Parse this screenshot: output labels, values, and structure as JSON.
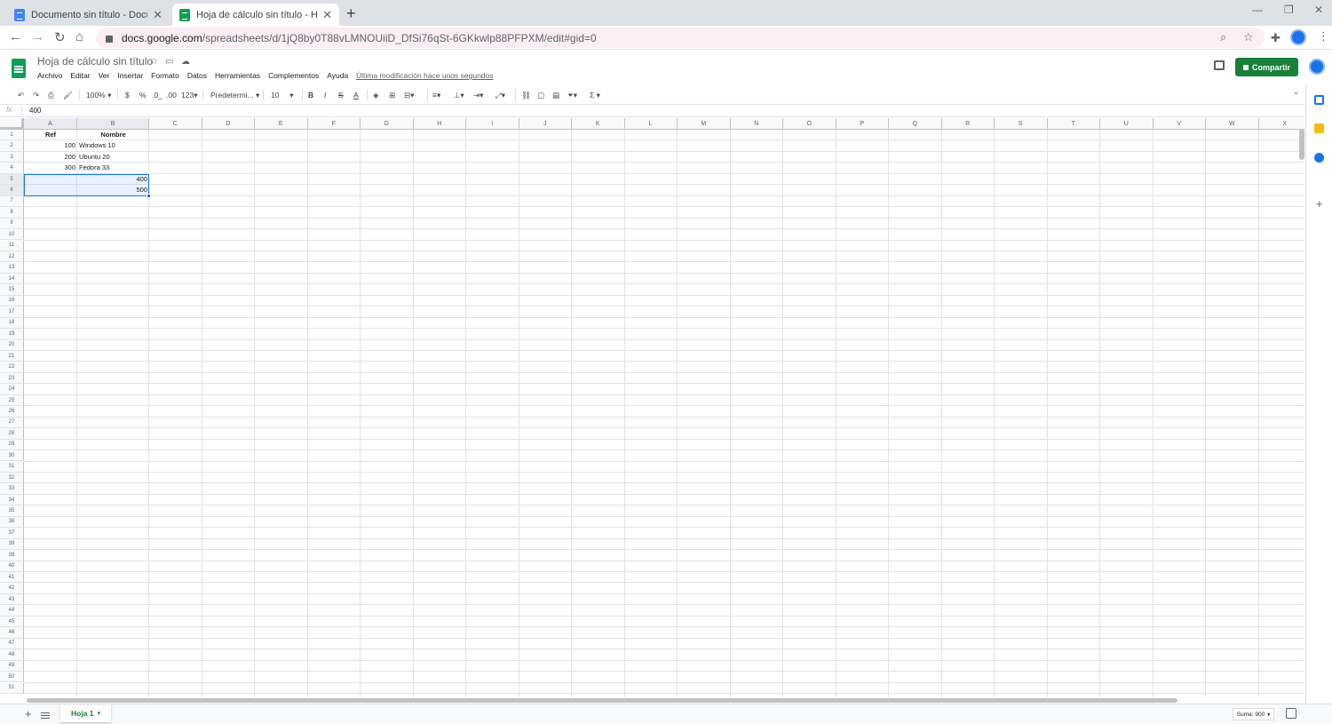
{
  "browser": {
    "tabs": [
      {
        "title": "Documento sin título - Documen"
      },
      {
        "title": "Hoja de cálculo sin título - Hojas"
      }
    ],
    "url_host": "docs.google.com",
    "url_path": "/spreadsheets/d/1jQ8by0T88vLMNOUiiD_DfSi76qSt-6GKkwlp88PFPXM/edit#gid=0"
  },
  "app": {
    "title": "Hoja de cálculo sin título",
    "menu": [
      "Archivo",
      "Editar",
      "Ver",
      "Insertar",
      "Formato",
      "Datos",
      "Herramientas",
      "Complementos",
      "Ayuda"
    ],
    "last_modified": "Última modificación hace unos segundos",
    "share_label": "Compartir"
  },
  "toolbar": {
    "zoom": "100%",
    "currency": "$",
    "percent": "%",
    "dec_minus": ".0_",
    "dec_plus": ".00",
    "more_formats": "123",
    "font": "Predetermi...",
    "font_size": "10",
    "bold": "B",
    "italic": "I",
    "strike": "S",
    "text_color": "A",
    "sigma": "Σ"
  },
  "formula_bar": {
    "fx": "fx",
    "value": "400"
  },
  "sheet": {
    "columns": [
      "A",
      "B",
      "C",
      "D",
      "E",
      "F",
      "G",
      "H",
      "I",
      "J",
      "K",
      "L",
      "M",
      "N",
      "O",
      "P",
      "Q",
      "R",
      "S",
      "T",
      "U",
      "V",
      "W",
      "X"
    ],
    "cells": {
      "A1": "Ref",
      "B1": "Nombre",
      "A2": "100",
      "B2": "Windows 10",
      "A3": "200",
      "B3": "Ubuntu 20",
      "A4": "300",
      "B4": "Fedora 33",
      "B5": "400",
      "B6": "500"
    },
    "row_count": 51,
    "selected_rows": [
      5,
      6
    ],
    "selected_columns": [
      "A",
      "B"
    ]
  },
  "sheetbar": {
    "tab": "Hoja 1",
    "sum": "Suma: 900"
  },
  "colors": {
    "accent": "#1a73e8",
    "share": "#188038",
    "sheets_green": "#0f9d58"
  }
}
